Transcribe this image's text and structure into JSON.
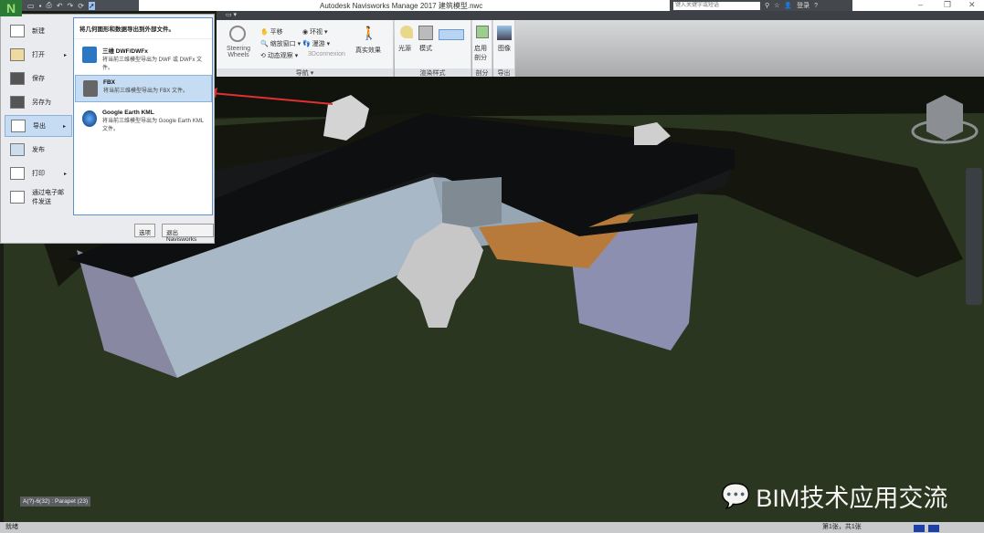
{
  "app": {
    "logo": "N",
    "title": "Autodesk Navisworks Manage 2017   建筑模型.nwc",
    "search_placeholder": "键入关键字或短语",
    "signin": "登录"
  },
  "ribbon": {
    "steering": "Steering Wheels",
    "pan": "平移",
    "zoom_window": "缩放窗口",
    "orbit": "动态观察",
    "look": "环视",
    "walk": "漫游",
    "connexion": "3Dconnexion",
    "realism": "真实效果",
    "nav_label": "导航 ▾",
    "light": "光源",
    "mode": "模式",
    "render_label": "渲染样式",
    "enable_section": "启用剖分",
    "section_label": "剖分",
    "image": "图像",
    "export_label": "导出"
  },
  "app_menu": {
    "items": [
      {
        "label": "新建"
      },
      {
        "label": "打开",
        "arrow": "▸"
      },
      {
        "label": "保存"
      },
      {
        "label": "另存为"
      },
      {
        "label": "导出",
        "arrow": "▸"
      },
      {
        "label": "发布"
      },
      {
        "label": "打印",
        "arrow": "▸"
      },
      {
        "label": "通过电子邮件发送"
      }
    ],
    "submenu_header": "将几何图形和数据导出到外部文件。",
    "export_items": [
      {
        "title": "三维 DWF/DWFx",
        "desc": "将当前三维模型导出为 DWF 或 DWFx 文件。"
      },
      {
        "title": "FBX",
        "desc": "将当前三维模型导出为 FBX 文件。"
      },
      {
        "title": "Google Earth KML",
        "desc": "将当前三维模型导出为 Google Earth KML 文件。"
      }
    ],
    "options_button": "选项",
    "exit_button": "退出 Navisworks"
  },
  "viewport": {
    "tooltip": "A(?)-6(32) : Parapet (23)",
    "watermark": "BIM技术应用交流"
  },
  "status": {
    "text": "就绪",
    "page": "第1张，共1张"
  },
  "colors": {
    "accent": "#c5dcf3",
    "arrow": "#e03030"
  }
}
